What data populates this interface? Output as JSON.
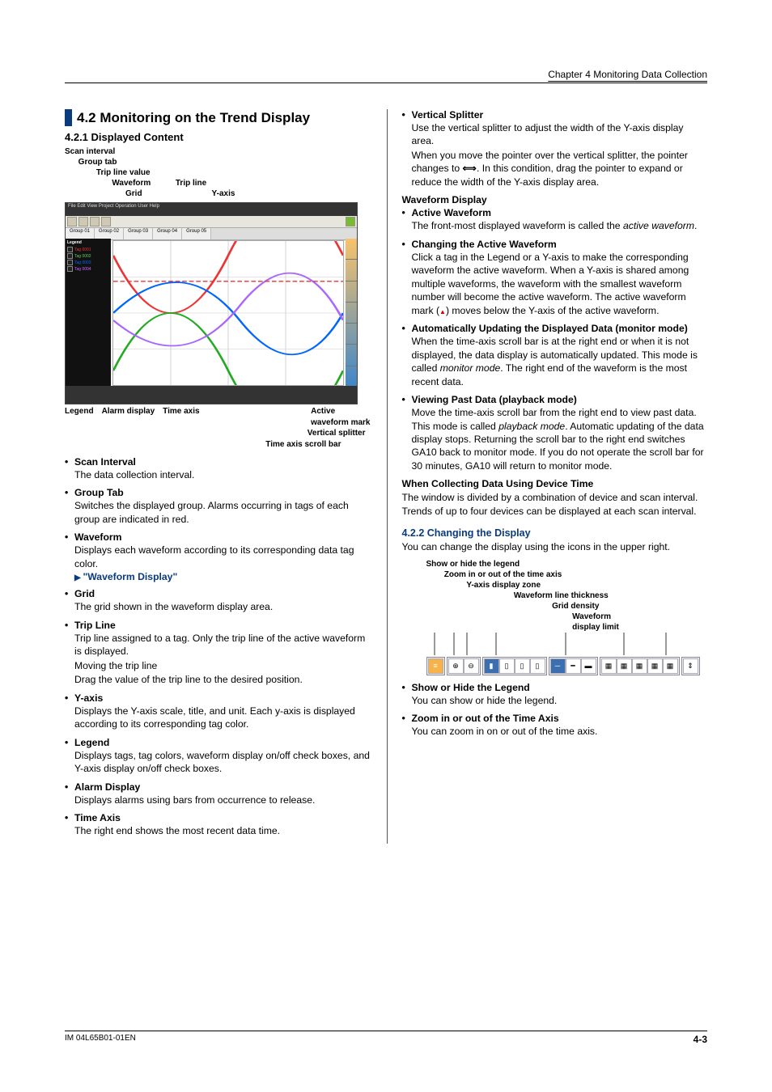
{
  "running_head": "Chapter 4  Monitoring Data Collection",
  "section_title": "4.2   Monitoring on the Trend Display",
  "sub_421": "4.2.1  Displayed Content",
  "fig_annotations_top": [
    "Scan interval",
    "      Group tab",
    "              Trip line value",
    "                     Waveform           Trip line",
    "                           Grid                               Y-axis"
  ],
  "fig_annotations_bottom": {
    "row1_left": [
      "Legend",
      "Alarm display",
      "Time axis"
    ],
    "row1_right_top": "Active",
    "row1_right_bottom": "waveform mark",
    "vsplitter": "Vertical splitter",
    "tscroll": "Time axis scroll bar"
  },
  "left_bullets": [
    {
      "t": "Scan Interval",
      "b": "The data collection interval."
    },
    {
      "t": "Group Tab",
      "b": "Switches the displayed group. Alarms occurring in tags of each group are indicated in red."
    },
    {
      "t": "Waveform",
      "b": "Displays each waveform according to its corresponding data tag color.",
      "xref": "\"Waveform Display\""
    },
    {
      "t": "Grid",
      "b": "The grid shown in the waveform display area."
    },
    {
      "t": "Trip Line",
      "b": "Trip line assigned to a tag. Only the trip line of the active waveform is displayed.",
      "extra1": "Moving the trip line",
      "extra2": "Drag the value of the trip line to the desired position."
    },
    {
      "t": "Y-axis",
      "b": "Displays the Y-axis scale, title, and unit. Each y-axis is displayed according to its corresponding tag color."
    },
    {
      "t": "Legend",
      "b": "Displays tags, tag colors, waveform display on/off check boxes, and Y-axis display on/off check boxes."
    },
    {
      "t": "Alarm Display",
      "b": "Displays alarms using bars from occurrence to release."
    },
    {
      "t": "Time Axis",
      "b": "The right end shows the most recent data time."
    }
  ],
  "right_bullets_top": [
    {
      "t": "Vertical Splitter",
      "b": "Use the vertical splitter to adjust the width of the Y-axis display area.",
      "b2pre": "When you move the pointer over the vertical splitter, the pointer changes to ",
      "b2post": ". In this condition, drag the pointer to expand or reduce the width of the Y-axis display area."
    }
  ],
  "wfd_heading": "Waveform Display",
  "wfd_bullets": [
    {
      "t": "Active Waveform",
      "b_pre": "The front-most displayed waveform is called the ",
      "b_em": "active waveform",
      "b_post": "."
    },
    {
      "t": "Changing the Active Waveform",
      "b": "Click a tag in the Legend or a Y-axis to make the corresponding waveform the active waveform. When a Y-axis is shared among multiple waveforms, the waveform with the smallest waveform number will become the active waveform. The active waveform mark (",
      "b_post": ") moves below the Y-axis of the active waveform."
    },
    {
      "t": "Automatically Updating the Displayed Data (monitor mode)",
      "b_pre": "When the time-axis scroll bar is at the right end or when it is not displayed, the data display is automatically updated. This mode is called ",
      "b_em": "monitor mode",
      "b_post": ". The right end of the waveform is the most recent data."
    },
    {
      "t": "Viewing Past Data (playback mode)",
      "b_pre": "Move the time-axis scroll bar from the right end to view past data. This mode is called ",
      "b_em": "playback mode",
      "b_post": ". Automatic updating of the data display stops. Returning the scroll bar to the right end switches GA10 back to monitor mode. If you do not operate the scroll bar for 30 minutes, GA10 will return to monitor mode."
    }
  ],
  "devtime_heading": "When Collecting Data Using Device Time",
  "devtime_body": "The window is divided by a combination of device and scan interval. Trends of up to four devices can be displayed at each scan interval.",
  "sub_422": "4.2.2  Changing the Display",
  "sub_422_intro": "You can change the display using the icons in the upper right.",
  "icon_annots": [
    "Show or hide the legend",
    "        Zoom in or out of the time axis",
    "                  Y-axis display zone",
    "                                       Waveform line thickness",
    "                                                        Grid density",
    "                                                                 Waveform",
    "                                                                 display limit"
  ],
  "post_icon_bullets": [
    {
      "t": "Show or Hide the Legend",
      "b": "You can show or hide the legend."
    },
    {
      "t": "Zoom in or out of the Time Axis",
      "b": "You can zoom in on or out of the time axis."
    }
  ],
  "footer_left": "IM 04L65B01-01EN",
  "footer_right": "4-3"
}
